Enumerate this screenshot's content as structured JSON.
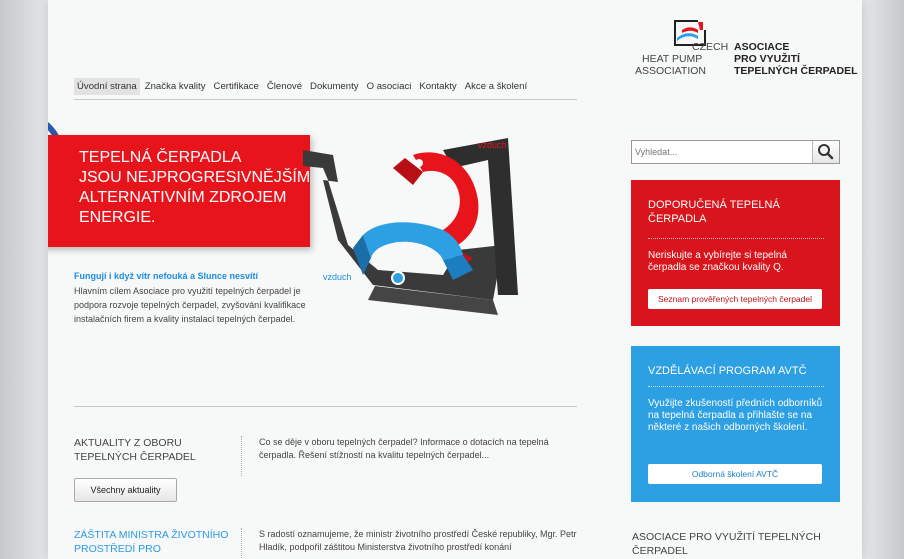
{
  "nav": {
    "items": [
      "Úvodní strana",
      "Značka kvality",
      "Certifikace",
      "Členové",
      "Dokumenty",
      "O asociaci",
      "Kontakty",
      "Akce a školení"
    ]
  },
  "logo": {
    "czech": "CZECH",
    "heat_pump": "HEAT PUMP",
    "association": "ASSOCIATION",
    "asociace": "ASOCIACE",
    "pro_vyuziti": "PRO VYUŽITÍ",
    "tepelnych": "TEPELNÝCH ČERPADEL"
  },
  "hero": {
    "headline": "TEPELNÁ ČERPADLA\nJSOU NEJPROGRESIVNĚJŠÍM\nALTERNATIVNÍM ZDROJEM\nENERGIE.",
    "label_top": "vzduch",
    "label_bottom": "vzduch"
  },
  "intro": {
    "title": "Fungují i když vítr nefouká a Slunce nesvítí",
    "text": "Hlavním cílem Asociace pro využití tepelných čerpadel je podpora rozvoje tepelných čerpadel, zvyšování kvalifikace instalačních firem a kvality instalací tepelných čerpadel."
  },
  "news": {
    "title": "AKTUALITY Z OBORU TEPELNÝCH ČERPADEL",
    "button": "Všechny aktuality",
    "text": "Co se děje v oboru tepelných čerpadel? Informace o dotacích na tepelná čerpadla. Řešení stížností na kvalitu tepelných čerpadel..."
  },
  "patron": {
    "title": "ZÁŠTITA MINISTRA ŽIVOTNÍHO PROSTŘEDÍ PRO",
    "text": "S radostí oznamujeme, že ministr životního prostředí České republiky, Mgr. Petr Hladík, podpořil záštitou Ministerstva životního prostředí konání"
  },
  "search": {
    "placeholder": "Vyhledat..."
  },
  "box_red": {
    "title": "DOPORUČENÁ TEPELNÁ ČERPADLA",
    "text": "Neriskujte a vybírejte si tepelná čerpadla se značkou kvality Q.",
    "button": "Seznam prověřených tepelných čerpadel"
  },
  "box_blue": {
    "title": "VZDĚLÁVACÍ PROGRAM AVTČ",
    "text": "Využijte zkušeností předních odborníků na tepelná čerpadla a přihlašte se na některé z našich odborných školení.",
    "button": "Odborná školení AVTČ"
  },
  "assoc": {
    "title": "ASOCIACE PRO VYUŽITÍ TEPELNÝCH ČERPADEL"
  },
  "colors": {
    "red": "#d8141c",
    "blue": "#2d9fe3",
    "link_blue": "#1d8de0"
  }
}
